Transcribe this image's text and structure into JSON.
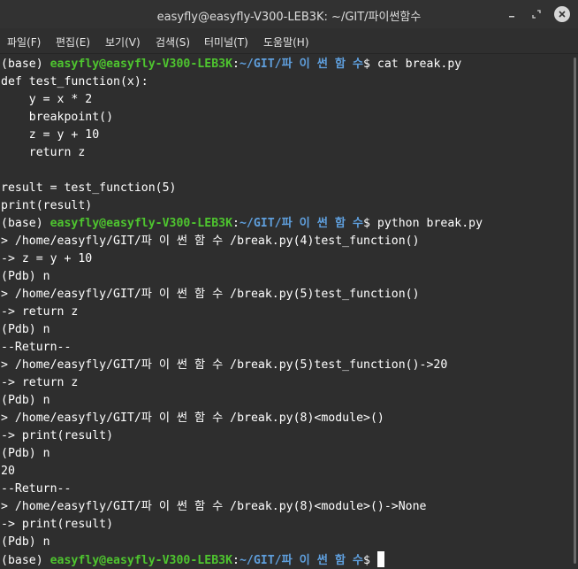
{
  "window": {
    "title": "easyfly@easyfly-V300-LEB3K: ~/GIT/파이썬함수"
  },
  "menu": {
    "items": [
      "파일(F)",
      "편집(E)",
      "보기(V)",
      "검색(S)",
      "터미널(T)",
      "도움말(H)"
    ]
  },
  "terminal": {
    "prompt": {
      "env": "(base) ",
      "user": "easyfly@easyfly-V300-LEB3K",
      "colon": ":",
      "path": "~/GIT/파 이 썬 함 수",
      "dollar": "$ "
    },
    "commands": [
      "cat break.py",
      "python break.py"
    ],
    "source_lines": [
      "def test_function(x):",
      "    y = x * 2",
      "    breakpoint()",
      "    z = y + 10",
      "    return z",
      "",
      "result = test_function(5)",
      "print(result)"
    ],
    "output_lines": [
      "> /home/easyfly/GIT/파 이 썬 함 수 /break.py(4)test_function()",
      "-> z = y + 10",
      "(Pdb) n",
      "> /home/easyfly/GIT/파 이 썬 함 수 /break.py(5)test_function()",
      "-> return z",
      "(Pdb) n",
      "--Return--",
      "> /home/easyfly/GIT/파 이 썬 함 수 /break.py(5)test_function()->20",
      "-> return z",
      "(Pdb) n",
      "> /home/easyfly/GIT/파 이 썬 함 수 /break.py(8)<module>()",
      "-> print(result)",
      "(Pdb) n",
      "20",
      "--Return--",
      "> /home/easyfly/GIT/파 이 썬 함 수 /break.py(8)<module>()->None",
      "-> print(result)",
      "(Pdb) n"
    ]
  }
}
